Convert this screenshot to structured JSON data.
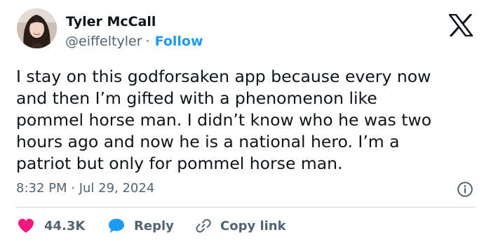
{
  "author": {
    "name": "Tyler McCall",
    "handle": "@eiffeltyler",
    "separator": "·",
    "follow_label": "Follow"
  },
  "tweet": {
    "text": "I stay on this godforsaken app because every now\nand then I’m gifted with a phenomenon like\npommel horse man. I didn’t know who he was two\nhours ago and now he is a national hero. I’m a\npatriot but only for pommel horse man.",
    "timestamp": "8:32 PM · Jul 29, 2024"
  },
  "actions": {
    "like_count": "44.3K",
    "reply_label": "Reply",
    "copy_link_label": "Copy link"
  },
  "icons": {
    "logo": "x-logo-icon",
    "info": "info-icon",
    "like": "heart-icon",
    "reply": "speech-bubble-icon",
    "copy": "link-icon"
  },
  "colors": {
    "accent": "#1d9bf0",
    "like": "#f91880",
    "text": "#0f1419",
    "muted": "#536471",
    "divider": "#cfd9de"
  }
}
